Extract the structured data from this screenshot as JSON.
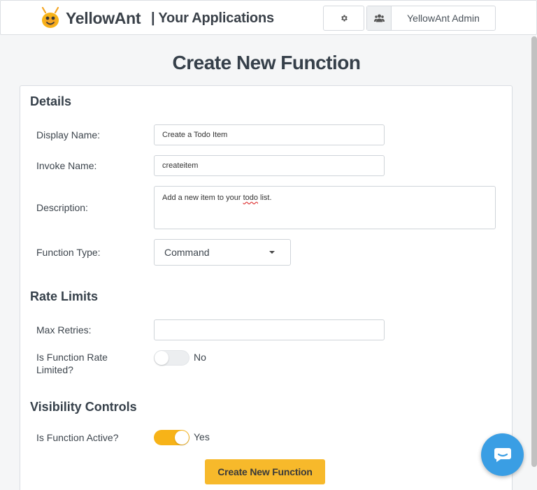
{
  "header": {
    "brand": "YellowAnt",
    "subtitle": "| Your Applications",
    "settings_icon": "gear-icon",
    "user_icon": "users-icon",
    "user_label": "YellowAnt Admin"
  },
  "page": {
    "title": "Create New Function"
  },
  "details": {
    "heading": "Details",
    "display_name_label": "Display Name:",
    "display_name_value": "Create a Todo Item",
    "invoke_name_label": "Invoke Name:",
    "invoke_name_value": "createitem",
    "description_label": "Description:",
    "description_before": "Add a new item to your ",
    "description_misspelled": "todo",
    "description_after": " list.",
    "function_type_label": "Function Type:",
    "function_type_value": "Command"
  },
  "rate_limits": {
    "heading": "Rate Limits",
    "max_retries_label": "Max Retries:",
    "max_retries_value": "",
    "rate_limited_label_line1": "Is Function Rate",
    "rate_limited_label_line2": "Limited?",
    "rate_limited_state": "No"
  },
  "visibility": {
    "heading": "Visibility Controls",
    "active_label": "Is Function Active?",
    "active_state": "Yes"
  },
  "actions": {
    "submit_label": "Create New Function"
  },
  "colors": {
    "accent": "#f7b92b",
    "toggle_on": "#f7b318",
    "chat": "#3a9ee4"
  },
  "chat_widget_icon": "chat-icon"
}
